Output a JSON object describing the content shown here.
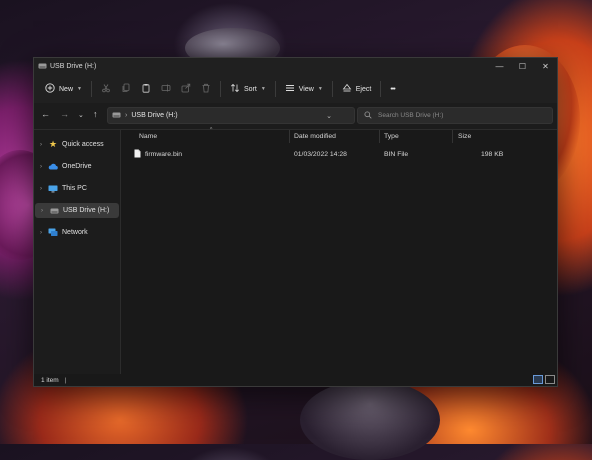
{
  "window": {
    "title": "USB Drive (H:)"
  },
  "controls": {
    "minimize": "—",
    "maximize": "☐",
    "close": "✕"
  },
  "toolbar": {
    "new_label": "New",
    "sort_label": "Sort",
    "view_label": "View",
    "eject_label": "Eject",
    "more_label": "•••"
  },
  "address": {
    "path": "USB Drive (H:)",
    "search_placeholder": "Search USB Drive (H:)"
  },
  "sidebar": {
    "items": [
      {
        "label": "Quick access"
      },
      {
        "label": "OneDrive"
      },
      {
        "label": "This PC"
      },
      {
        "label": "USB Drive (H:)"
      },
      {
        "label": "Network"
      }
    ]
  },
  "table": {
    "columns": [
      "Name",
      "Date modified",
      "Type",
      "Size"
    ],
    "rows": [
      {
        "name": "firmware.bin",
        "date": "01/03/2022 14:28",
        "type": "BIN File",
        "size": "198 KB"
      }
    ]
  },
  "status": {
    "count": "1 item",
    "cursor": "|"
  },
  "colors": {
    "accent": "#4aa3ff",
    "folder": "#f2c94c",
    "window_bg": "#191919"
  }
}
